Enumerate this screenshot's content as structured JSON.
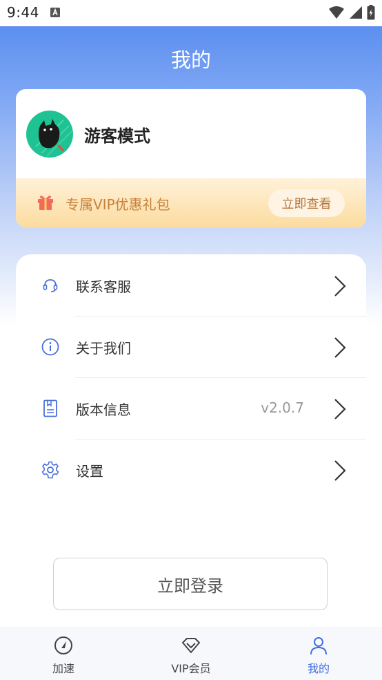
{
  "status_bar": {
    "time": "9:44"
  },
  "header": {
    "title": "我的"
  },
  "profile": {
    "username": "游客模式"
  },
  "vip_banner": {
    "text": "专属VIP优惠礼包",
    "button_label": "立即查看"
  },
  "menu": {
    "items": [
      {
        "label": "联系客服",
        "icon": "headset-icon",
        "value": ""
      },
      {
        "label": "关于我们",
        "icon": "info-icon",
        "value": ""
      },
      {
        "label": "版本信息",
        "icon": "document-icon",
        "value": "v2.0.7"
      },
      {
        "label": "设置",
        "icon": "gear-icon",
        "value": ""
      }
    ]
  },
  "login": {
    "button_label": "立即登录"
  },
  "bottom_nav": {
    "items": [
      {
        "label": "加速",
        "icon": "speedometer-icon",
        "active": false
      },
      {
        "label": "VIP会员",
        "icon": "diamond-icon",
        "active": false
      },
      {
        "label": "我的",
        "icon": "user-icon",
        "active": true
      }
    ]
  },
  "colors": {
    "accent": "#3f6fe0",
    "header_gradient_top": "#4f86ee",
    "vip_text": "#c7803a",
    "avatar_bg": "#1fc393"
  }
}
